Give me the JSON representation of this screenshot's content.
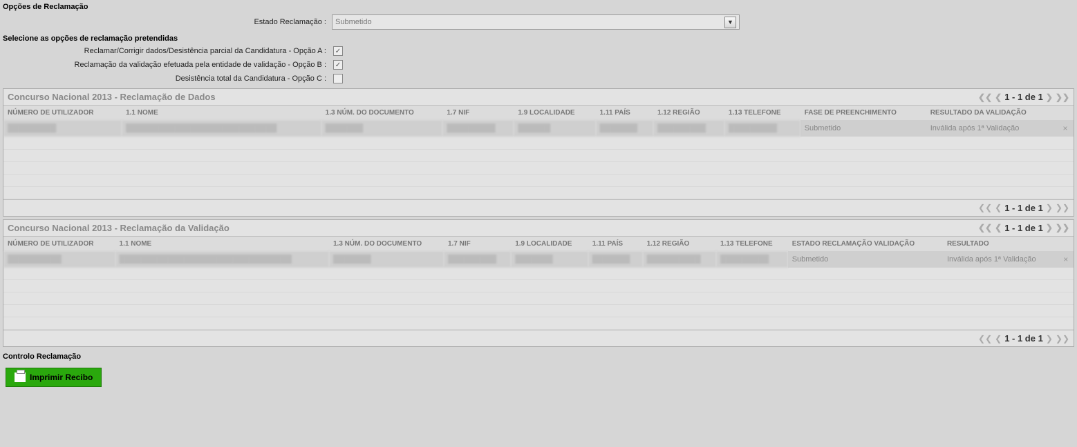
{
  "opcoes": {
    "title": "Opções de Reclamação",
    "estado_label": "Estado Reclamação :",
    "estado_value": "Submetido",
    "sub_title": "Selecione as opções de reclamação pretendidas",
    "opt_a_label": "Reclamar/Corrigir dados/Desistência parcial da Candidatura - Opção A :",
    "opt_b_label": "Reclamação da validação efetuada pela entidade de validação - Opção B :",
    "opt_c_label": "Desistência total da Candidatura - Opção C :",
    "opt_a_checked": "✓",
    "opt_b_checked": "✓",
    "opt_c_checked": ""
  },
  "panel1": {
    "title": "Concurso Nacional 2013 - Reclamação de Dados",
    "pager": "1 - 1 de 1",
    "headers": {
      "num_util": "NÚMERO DE UTILIZADOR",
      "nome": "1.1 NOME",
      "num_doc": "1.3 NÚM. DO DOCUMENTO",
      "nif": "1.7 NIF",
      "localidade": "1.9 LOCALIDADE",
      "pais": "1.11 PAÍS",
      "regiao": "1.12 REGIÃO",
      "telefone": "1.13 TELEFONE",
      "fase": "FASE DE PREENCHIMENTO",
      "resultado": "RESULTADO DA VALIDAÇÃO"
    },
    "row": {
      "num_util": "█████████",
      "nome": "████████████████████████████",
      "num_doc": "███████",
      "nif": "█████████",
      "localidade": "██████",
      "pais": "███████",
      "regiao": "█████████",
      "telefone": "█████████",
      "fase": "Submetido",
      "resultado": "Inválida após 1ª Validação"
    }
  },
  "panel2": {
    "title": "Concurso Nacional 2013 - Reclamação da Validação",
    "pager": "1 - 1 de 1",
    "headers": {
      "num_util": "NÚMERO DE UTILIZADOR",
      "nome": "1.1 NOME",
      "num_doc": "1.3 NÚM. DO DOCUMENTO",
      "nif": "1.7 NIF",
      "localidade": "1.9 LOCALIDADE",
      "pais": "1.11 PAÍS",
      "regiao": "1.12 REGIÃO",
      "telefone": "1.13 TELEFONE",
      "estado": "ESTADO RECLAMAÇÃO VALIDAÇÃO",
      "resultado": "RESULTADO"
    },
    "row": {
      "num_util": "██████████",
      "nome": "████████████████████████████████",
      "num_doc": "███████",
      "nif": "█████████",
      "localidade": "███████",
      "pais": "███████",
      "regiao": "██████████",
      "telefone": "█████████",
      "estado": "Submetido",
      "resultado": "Inválida após 1ª Validação"
    }
  },
  "controlo": {
    "title": "Controlo Reclamação",
    "print_label": "Imprimir Recibo"
  }
}
